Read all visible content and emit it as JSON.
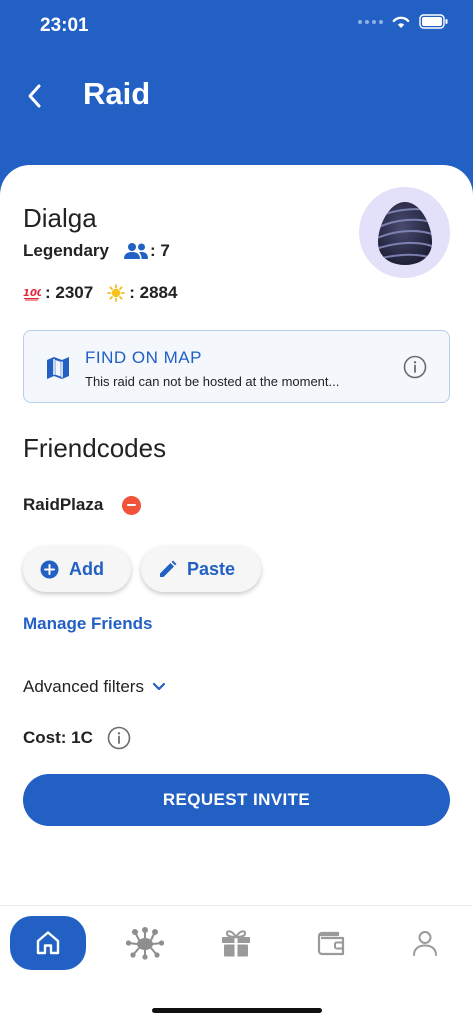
{
  "status_bar": {
    "time": "23:01"
  },
  "header": {
    "title": "Raid"
  },
  "raid": {
    "pokemon": "Dialga",
    "tier": "Legendary",
    "players_count": "7",
    "hundo_cp": "2307",
    "weather_cp": "2884"
  },
  "map_card": {
    "title": "FIND ON MAP",
    "subtitle": "This raid can not be hosted at the moment..."
  },
  "friendcodes": {
    "title": "Friendcodes",
    "items": [
      {
        "name": "RaidPlaza"
      }
    ],
    "add_label": "Add",
    "paste_label": "Paste",
    "manage_label": "Manage Friends"
  },
  "filters": {
    "label": "Advanced filters"
  },
  "cost": {
    "label": "Cost: 1C"
  },
  "request_button": {
    "label": "REQUEST INVITE"
  },
  "tabbar": {
    "tabs": [
      {
        "icon": "home-icon",
        "active": true
      },
      {
        "icon": "raid-boss-icon",
        "active": false
      },
      {
        "icon": "gift-icon",
        "active": false
      },
      {
        "icon": "wallet-icon",
        "active": false
      },
      {
        "icon": "profile-icon",
        "active": false
      }
    ]
  },
  "colors": {
    "primary": "#2260c4",
    "danger": "#f0533a",
    "egg_bg": "#e3e0fa"
  }
}
